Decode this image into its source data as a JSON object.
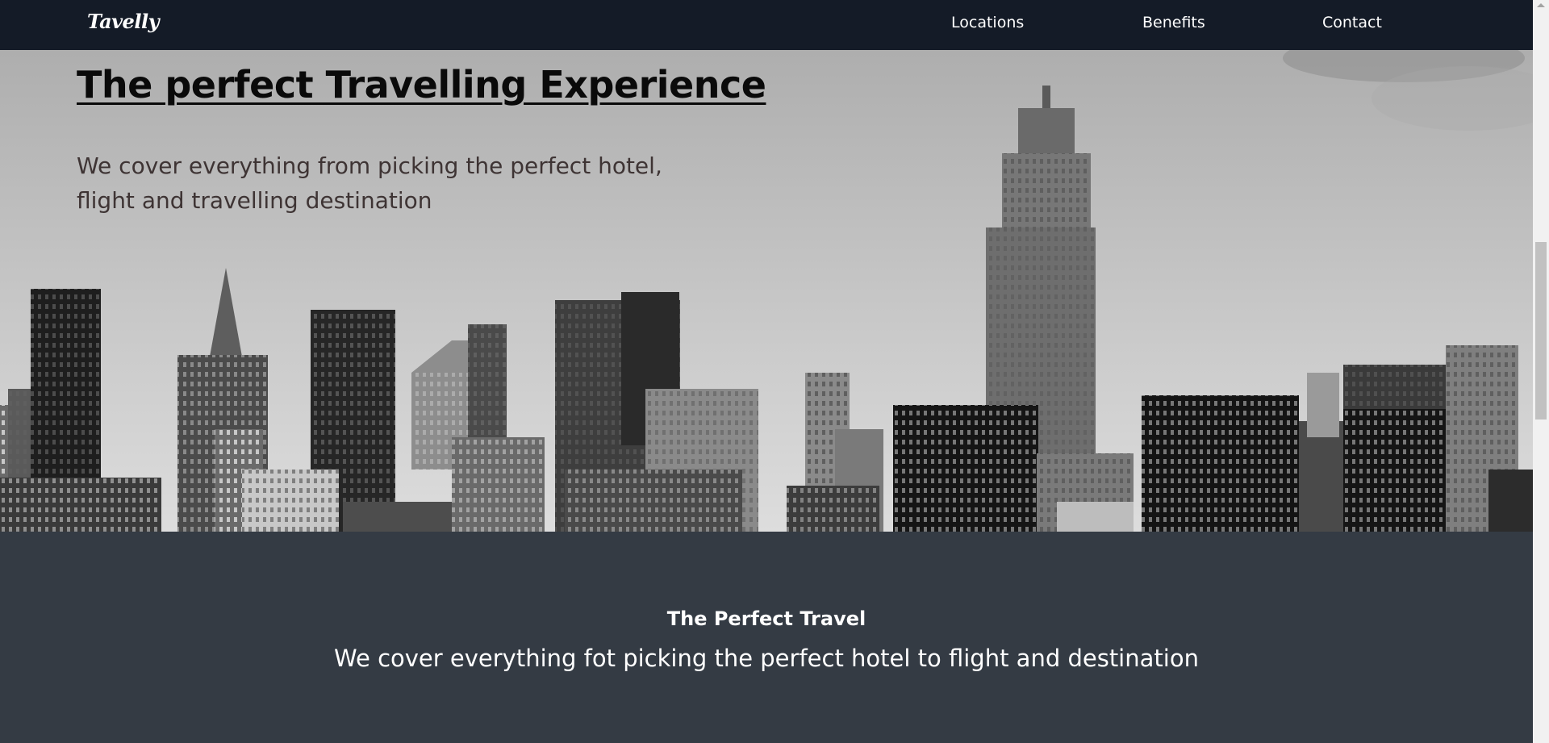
{
  "navbar": {
    "logo": "Tavelly",
    "links": [
      "Locations",
      "Benefits",
      "Contact"
    ]
  },
  "hero": {
    "title": "The perfect Travelling Experience",
    "subtitle": "We cover everything from picking the perfect hotel, flight and travelling destination"
  },
  "features": {
    "title": "The Perfect Travel",
    "subtitle": "We cover everything fot picking the perfect hotel to flight and destination"
  },
  "colors": {
    "navbar_bg": "#141b27",
    "section_bg": "#343b44",
    "text_light": "#ffffff",
    "hero_text": "#0a0a0a"
  }
}
